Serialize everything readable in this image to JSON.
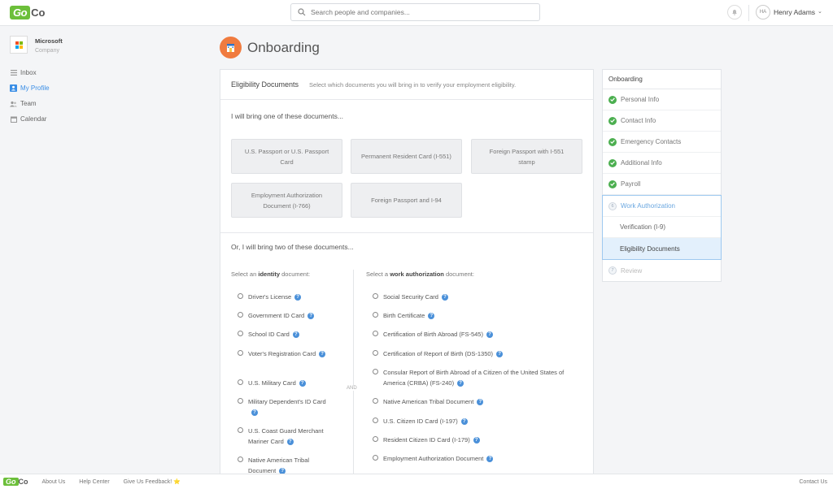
{
  "app": {
    "logo_go": "Go",
    "logo_co": "Co"
  },
  "search": {
    "placeholder": "Search people and companies..."
  },
  "user": {
    "initials": "HA",
    "name": "Henry Adams"
  },
  "company": {
    "name": "Microsoft",
    "subtitle": "Company"
  },
  "nav": [
    {
      "label": "Inbox",
      "icon": "inbox-icon"
    },
    {
      "label": "My Profile",
      "icon": "profile-icon",
      "active": true
    },
    {
      "label": "Team",
      "icon": "team-icon"
    },
    {
      "label": "Calendar",
      "icon": "calendar-icon"
    }
  ],
  "page": {
    "title": "Onboarding"
  },
  "card": {
    "title": "Eligibility Documents",
    "description": "Select which documents you will bring in to verify your employment eligibility.",
    "one_doc_title": "I will bring one of these documents...",
    "one_docs": [
      "U.S. Passport or U.S. Passport Card",
      "Permanent Resident Card (I-551)",
      "Foreign Passport with I-551 stamp",
      "Employment Authorization Document (I-766)",
      "Foreign Passport and I-94"
    ],
    "two_doc_title": "Or, I will bring two of these documents...",
    "identity_label_pre": "Select an ",
    "identity_label_bold": "identity",
    "identity_label_post": " document:",
    "work_label_pre": "Select a ",
    "work_label_bold": "work authorization",
    "work_label_post": " document:",
    "and_label": "AND",
    "identity_docs": [
      "Driver's License",
      "Government ID Card",
      "School ID Card",
      "Voter's Registration Card",
      "U.S. Military Card",
      "Military Dependent's ID Card",
      "U.S. Coast Guard Merchant Mariner Card",
      "Native American Tribal Document"
    ],
    "work_docs": [
      "Social Security Card",
      "Birth Certificate",
      "Certification of Birth Abroad (FS-545)",
      "Certification of Report of Birth (DS-1350)",
      "Consular Report of Birth Abroad of a Citizen of the United States of America (CRBA) (FS-240)",
      "Native American Tribal Document",
      "U.S. Citizen ID Card (I-197)",
      "Resident Citizen ID Card (I-179)",
      "Employment Authorization Document"
    ],
    "help_glyph": "?"
  },
  "steps": {
    "title": "Onboarding",
    "completed": [
      "Personal Info",
      "Contact Info",
      "Emergency Contacts",
      "Additional Info",
      "Payroll"
    ],
    "current_num": "6",
    "current": "Work Authorization",
    "substeps": [
      "Verification (I-9)",
      "Eligibility Documents"
    ],
    "next_num": "7",
    "next": "Review"
  },
  "footer": {
    "links": [
      "About Us",
      "Help Center",
      "Give Us Feedback! ⭐"
    ],
    "right": "Contact Us"
  },
  "colors": {
    "brand": "#6cbf3a",
    "accent": "#3a8ee6",
    "success": "#4caf50",
    "selected_bg": "#e3f0fc"
  }
}
